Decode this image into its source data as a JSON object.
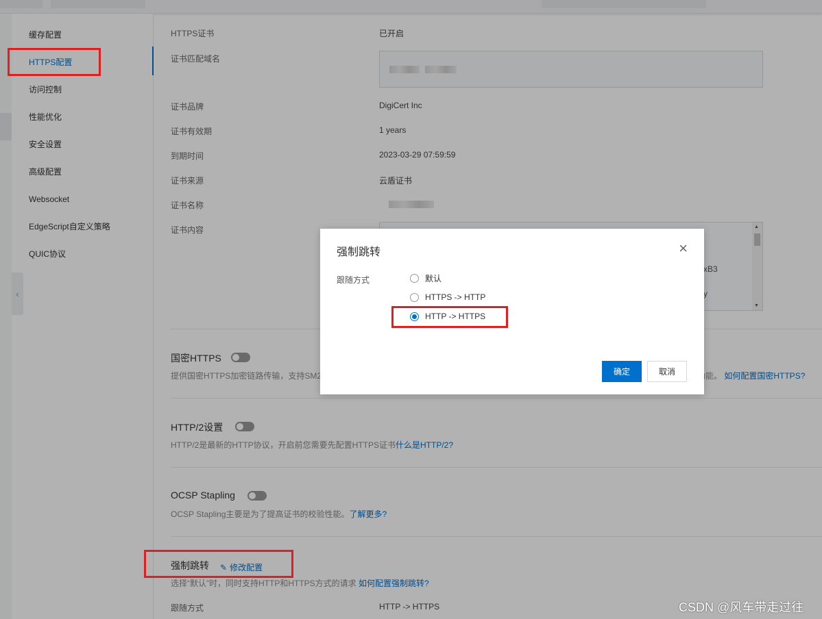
{
  "sidebar": {
    "items": [
      {
        "label": "缓存配置"
      },
      {
        "label": "HTTPS配置"
      },
      {
        "label": "访问控制"
      },
      {
        "label": "性能优化"
      },
      {
        "label": "安全设置"
      },
      {
        "label": "高级配置"
      },
      {
        "label": "Websocket"
      },
      {
        "label": "EdgeScript自定义策略"
      },
      {
        "label": "QUIC协议"
      }
    ],
    "active_index": 1
  },
  "cert": {
    "https_cert_label": "HTTPS证书",
    "https_cert_value": "已开启",
    "domain_label": "证书匹配域名",
    "brand_label": "证书品牌",
    "brand_value": "DigiCert Inc",
    "validity_label": "证书有效期",
    "validity_value": "1 years",
    "expire_label": "到期时间",
    "expire_value": "2023-03-29 07:59:59",
    "source_label": "证书来源",
    "source_value": "云盾证书",
    "name_label": "证书名称",
    "content_label": "证书内容",
    "content_snip_1": "xB3",
    "content_snip_2": "y"
  },
  "sections": {
    "gm_https": {
      "title": "国密HTTPS",
      "desc": "提供国密HTTPS加密链路传输，支持SM2",
      "desc_tail": "功能。",
      "link": "如何配置国密HTTPS?"
    },
    "http2": {
      "title": "HTTP/2设置",
      "desc": "HTTP/2是最新的HTTP协议，开启前您需要先配置HTTPS证书",
      "link": "什么是HTTP/2?"
    },
    "ocsp": {
      "title": "OCSP Stapling",
      "desc": "OCSP Stapling主要是为了提高证书的校验性能。",
      "link": "了解更多?"
    },
    "force_redirect": {
      "title": "强制跳转",
      "edit": "修改配置",
      "desc": "选择“默认”时，同时支持HTTP和HTTPS方式的请求",
      "link": "如何配置强制跳转?",
      "follow_label": "跟随方式",
      "follow_value": "HTTP -> HTTPS"
    }
  },
  "dialog": {
    "title": "强制跳转",
    "close": "×",
    "label": "跟随方式",
    "options": [
      {
        "label": "默认"
      },
      {
        "label": "HTTPS -> HTTP"
      },
      {
        "label": "HTTP -> HTTPS"
      }
    ],
    "selected_index": 2,
    "ok": "确定",
    "cancel": "取消"
  },
  "icons": {
    "close": "close-icon",
    "edit": "pencil-icon",
    "collapse": "chevron-left-icon"
  },
  "colors": {
    "accent": "#0070cc",
    "annotation": "#e02020"
  },
  "watermark": "CSDN @风车带走过往"
}
